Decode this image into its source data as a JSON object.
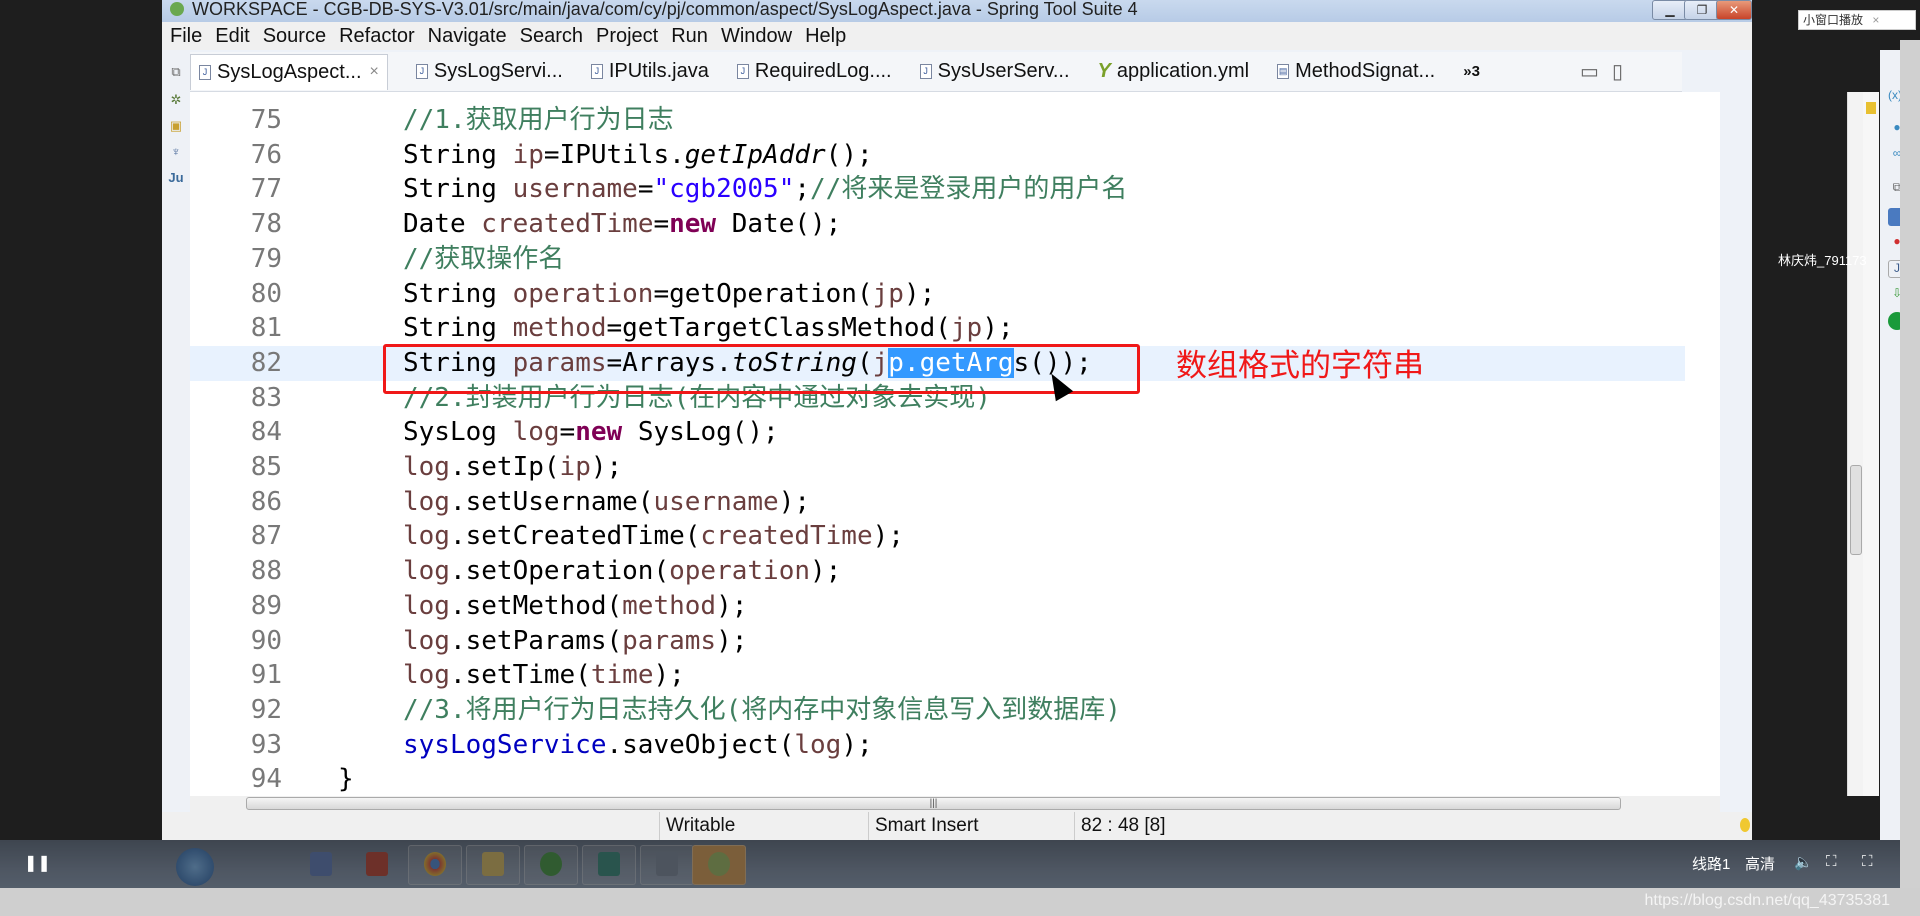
{
  "window": {
    "title": "WORKSPACE - CGB-DB-SYS-V3.01/src/main/java/com/cy/pj/common/aspect/SysLogAspect.java - Spring Tool Suite 4"
  },
  "menu": [
    "File",
    "Edit",
    "Source",
    "Refactor",
    "Navigate",
    "Search",
    "Project",
    "Run",
    "Window",
    "Help"
  ],
  "tabs": [
    {
      "label": "SysLogAspect...",
      "active": true,
      "close": "×"
    },
    {
      "label": "SysLogServi..."
    },
    {
      "label": "IPUtils.java"
    },
    {
      "label": "RequiredLog...."
    },
    {
      "label": "SysUserServ..."
    },
    {
      "label": "application.yml"
    },
    {
      "label": "MethodSignat..."
    }
  ],
  "tabs_overflow": "»3",
  "code": [
    {
      "n": "75",
      "tokens": [
        [
          "//1.获取用户行为日志",
          "c"
        ]
      ]
    },
    {
      "n": "76",
      "tokens": [
        [
          "String ",
          ""
        ],
        [
          "ip",
          "v"
        ],
        [
          "=IPUtils.",
          ""
        ],
        [
          "getIpAddr",
          "i"
        ],
        [
          "();",
          ""
        ]
      ]
    },
    {
      "n": "77",
      "tokens": [
        [
          "String ",
          ""
        ],
        [
          "username",
          "v"
        ],
        [
          "=",
          ""
        ],
        [
          "\"cgb2005\"",
          "s"
        ],
        [
          ";",
          ""
        ],
        [
          "//将来是登录用户的用户名",
          "c"
        ]
      ]
    },
    {
      "n": "78",
      "tokens": [
        [
          "Date ",
          ""
        ],
        [
          "createdTime",
          "v"
        ],
        [
          "=",
          ""
        ],
        [
          "new",
          "k"
        ],
        [
          " Date();",
          ""
        ]
      ]
    },
    {
      "n": "79",
      "tokens": [
        [
          "//获取操作名",
          "c"
        ]
      ]
    },
    {
      "n": "80",
      "tokens": [
        [
          "String ",
          ""
        ],
        [
          "operation",
          "v"
        ],
        [
          "=getOperation(",
          ""
        ],
        [
          "jp",
          "v"
        ],
        [
          ");",
          ""
        ]
      ]
    },
    {
      "n": "81",
      "tokens": [
        [
          "String ",
          ""
        ],
        [
          "method",
          "v"
        ],
        [
          "=getTargetClassMethod(",
          ""
        ],
        [
          "jp",
          "v"
        ],
        [
          ");",
          ""
        ]
      ]
    },
    {
      "n": "82",
      "current": true,
      "tokens": [
        [
          "String ",
          ""
        ],
        [
          "params",
          "v"
        ],
        [
          "=Arrays.",
          ""
        ],
        [
          "toString",
          "i"
        ],
        [
          "(",
          ""
        ],
        [
          "j",
          "v"
        ],
        [
          "p.getArg",
          "sel"
        ],
        [
          "s());",
          ""
        ]
      ]
    },
    {
      "n": "83",
      "tokens": [
        [
          "//2.封装用户行为日志(在内容中通过对象去实现)",
          "c"
        ]
      ]
    },
    {
      "n": "84",
      "tokens": [
        [
          "SysLog ",
          ""
        ],
        [
          "log",
          "v"
        ],
        [
          "=",
          ""
        ],
        [
          "new",
          "k"
        ],
        [
          " SysLog();",
          ""
        ]
      ]
    },
    {
      "n": "85",
      "tokens": [
        [
          "log",
          "v"
        ],
        [
          ".setIp(",
          ""
        ],
        [
          "ip",
          "v"
        ],
        [
          ");",
          ""
        ]
      ]
    },
    {
      "n": "86",
      "tokens": [
        [
          "log",
          "v"
        ],
        [
          ".setUsername(",
          ""
        ],
        [
          "username",
          "v"
        ],
        [
          ");",
          ""
        ]
      ]
    },
    {
      "n": "87",
      "tokens": [
        [
          "log",
          "v"
        ],
        [
          ".setCreatedTime(",
          ""
        ],
        [
          "createdTime",
          "v"
        ],
        [
          ");",
          ""
        ]
      ]
    },
    {
      "n": "88",
      "tokens": [
        [
          "log",
          "v"
        ],
        [
          ".setOperation(",
          ""
        ],
        [
          "operation",
          "v"
        ],
        [
          ");",
          ""
        ]
      ]
    },
    {
      "n": "89",
      "tokens": [
        [
          "log",
          "v"
        ],
        [
          ".setMethod(",
          ""
        ],
        [
          "method",
          "v"
        ],
        [
          ");",
          ""
        ]
      ]
    },
    {
      "n": "90",
      "tokens": [
        [
          "log",
          "v"
        ],
        [
          ".setParams(",
          ""
        ],
        [
          "params",
          "v"
        ],
        [
          ");",
          ""
        ]
      ]
    },
    {
      "n": "91",
      "tokens": [
        [
          "log",
          "v"
        ],
        [
          ".setTime(",
          ""
        ],
        [
          "time",
          "v"
        ],
        [
          ");",
          ""
        ]
      ]
    },
    {
      "n": "92",
      "tokens": [
        [
          "//3.将用户行为日志持久化(将内存中对象信息写入到数据库)",
          "c"
        ]
      ]
    },
    {
      "n": "93",
      "tokens": [
        [
          "sysLogService",
          "f"
        ],
        [
          ".saveObject(",
          ""
        ],
        [
          "log",
          "v"
        ],
        [
          ");",
          ""
        ]
      ]
    },
    {
      "n": "94",
      "outdent": true,
      "tokens": [
        [
          "}",
          ""
        ]
      ]
    }
  ],
  "annotation": "数组格式的字符串",
  "status": {
    "mode": "Writable",
    "insert": "Smart Insert",
    "position": "82 : 48 [8]"
  },
  "player": {
    "line": "线路1",
    "quality": "高清",
    "pip": "小窗口播放",
    "pip_close": "×",
    "user": "林庆炜_791173"
  },
  "watermark": "https://blog.csdn.net/qq_43735381",
  "colors": {
    "annotation": "#f01818",
    "selection": "#3399ff",
    "comment": "#3f7f5f",
    "keyword": "#7f0055",
    "string": "#2a00ff"
  }
}
